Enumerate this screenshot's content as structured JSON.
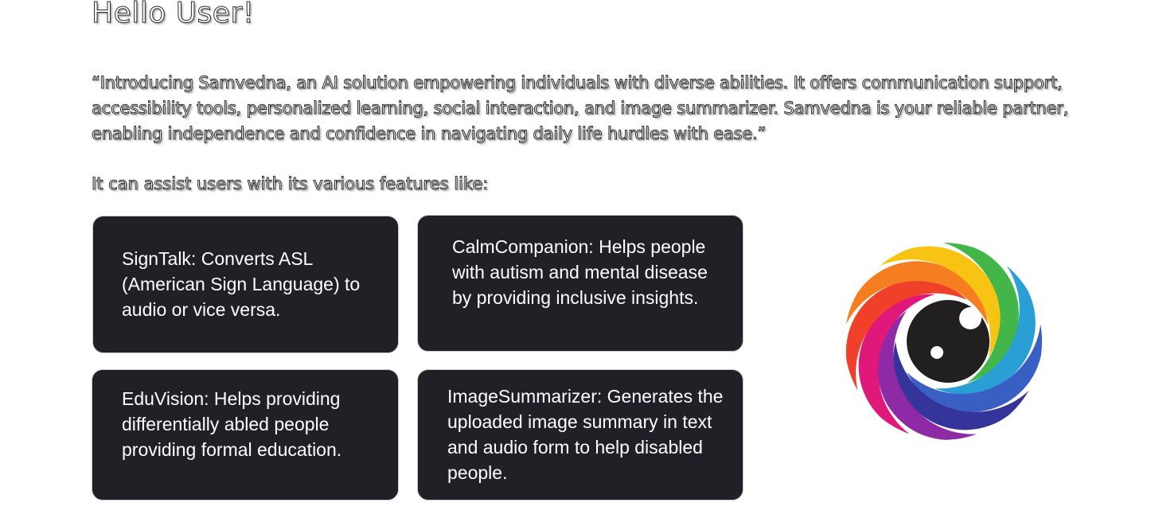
{
  "greeting": "Hello User!",
  "intro": "“Introducing Samvedna, an AI solution empowering individuals with diverse abilities. It offers communication support, accessibility tools, personalized learning,  social interaction, and image summarizer. Samvedna is your reliable partner, enabling independence and confidence in navigating daily life hurdles with ease.”",
  "features_lead": "It can assist users with its various features like:",
  "features": [
    {
      "text": "SignTalk: Converts ASL (American Sign Language) to audio or vice versa."
    },
    {
      "text": "CalmCompanion: Helps people with autism and mental disease by providing inclusive insights."
    },
    {
      "text": "EduVision: Helps providing differentially abled people providing formal education."
    },
    {
      "text": "ImageSummarizer: Generates the uploaded image summary in text and audio form to help disabled people."
    }
  ],
  "logo": {
    "icon": "rainbow-eye-icon",
    "colors": [
      "#43b649",
      "#2a9fd6",
      "#3a5fc4",
      "#34349a",
      "#8e2aa6",
      "#e0187a",
      "#f0402a",
      "#f57f20",
      "#f7c414"
    ],
    "pupil_color": "#221f20"
  }
}
